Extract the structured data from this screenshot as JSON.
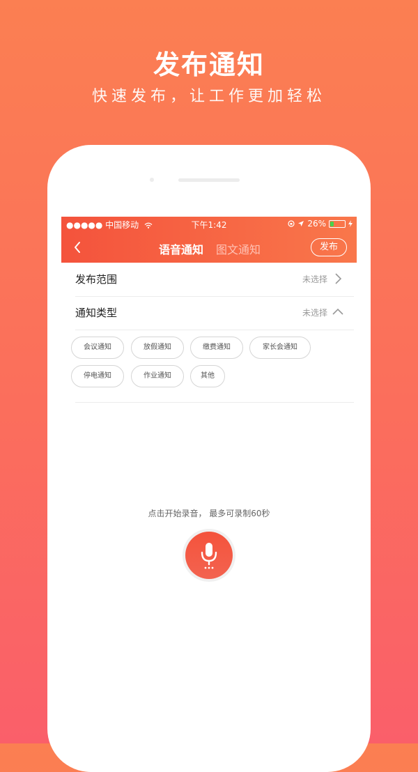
{
  "hero": {
    "title": "发布通知",
    "subtitle": "快速发布，让工作更加轻松"
  },
  "status_bar": {
    "carrier": "●●●●● 中国移动",
    "time": "下午1:42",
    "battery": "26%",
    "battery_level": 0.26
  },
  "nav": {
    "tab_voice": "语音通知",
    "tab_image_text": "图文通知",
    "publish": "发布"
  },
  "form": {
    "scope": {
      "label": "发布范围",
      "value": "未选择"
    },
    "type": {
      "label": "通知类型",
      "value": "未选择"
    }
  },
  "chips": [
    "会议通知",
    "放假通知",
    "缴费通知",
    "家长会通知",
    "停电通知",
    "作业通知",
    "其他"
  ],
  "record": {
    "hint": "点击开始录音， 最多可录制60秒"
  },
  "colors": {
    "accent": "#f4533c",
    "background_top": "#fb7f52",
    "background_bottom": "#fa5f6a"
  },
  "icons": {
    "back": "chevron-left-icon",
    "scope_arrow": "chevron-right-icon",
    "type_arrow": "chevron-up-icon",
    "mic": "microphone-icon"
  }
}
